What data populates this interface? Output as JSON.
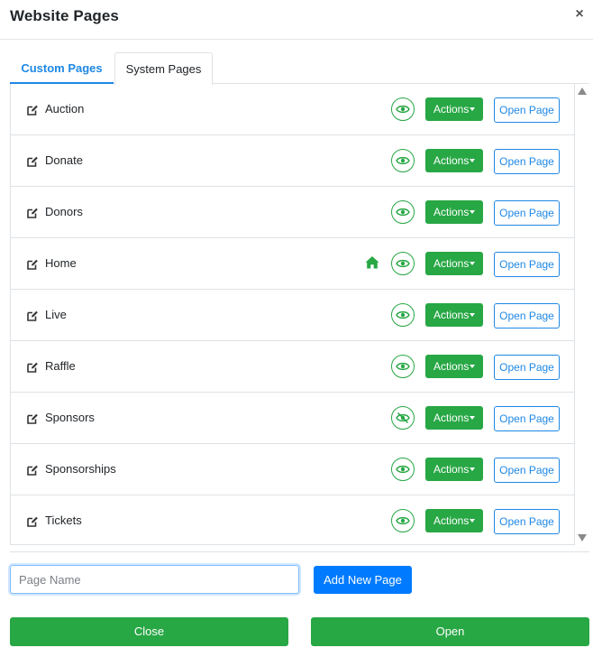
{
  "header": {
    "title": "Website Pages",
    "close_glyph": "×"
  },
  "tabs": [
    {
      "label": "Custom Pages",
      "active": true
    },
    {
      "label": "System Pages",
      "active": false
    }
  ],
  "pages": [
    {
      "name": "Auction",
      "home": false,
      "visible": true,
      "actions_label": "Actions",
      "open_label": "Open Page"
    },
    {
      "name": "Donate",
      "home": false,
      "visible": true,
      "actions_label": "Actions",
      "open_label": "Open Page"
    },
    {
      "name": "Donors",
      "home": false,
      "visible": true,
      "actions_label": "Actions",
      "open_label": "Open Page"
    },
    {
      "name": "Home",
      "home": true,
      "visible": true,
      "actions_label": "Actions",
      "open_label": "Open Page"
    },
    {
      "name": "Live",
      "home": false,
      "visible": true,
      "actions_label": "Actions",
      "open_label": "Open Page"
    },
    {
      "name": "Raffle",
      "home": false,
      "visible": true,
      "actions_label": "Actions",
      "open_label": "Open Page"
    },
    {
      "name": "Sponsors",
      "home": false,
      "visible": false,
      "actions_label": "Actions",
      "open_label": "Open Page"
    },
    {
      "name": "Sponsorships",
      "home": false,
      "visible": true,
      "actions_label": "Actions",
      "open_label": "Open Page"
    },
    {
      "name": "Tickets",
      "home": false,
      "visible": true,
      "actions_label": "Actions",
      "open_label": "Open Page"
    }
  ],
  "new_page": {
    "placeholder": "Page Name",
    "value": "",
    "add_label": "Add New Page"
  },
  "footer": {
    "close_label": "Close",
    "open_label": "Open"
  },
  "icons": {
    "edit": "edit-icon",
    "home": "home-icon",
    "eye": "eye-icon",
    "eye_off": "eye-slash-icon",
    "caret": "caret-down-icon",
    "scroll_up": "scroll-up-arrow-icon",
    "scroll_down": "scroll-down-arrow-icon"
  },
  "colors": {
    "green": "#28a745",
    "blue": "#1e88e5",
    "primary": "#007bff",
    "border": "#dee2e6"
  }
}
